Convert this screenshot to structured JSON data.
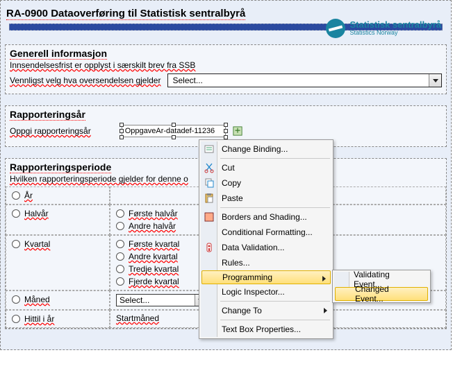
{
  "brand": {
    "name": "Statistisk sentralbyrå",
    "sub": "Statistics Norway",
    "accent": "#1a84a0"
  },
  "form": {
    "title": "RA-0900 Dataoverføring til Statistisk sentralbyrå",
    "general": {
      "heading": "Generell informasjon",
      "line1": "Innsendelsesfrist er opplyst i særskilt brev fra SSB",
      "prompt_label": "Vennligst velg hva oversendelsen gjelder",
      "select_placeholder": "Select..."
    },
    "year": {
      "heading": "Rapporteringsår",
      "label": "Oppgi rapporteringsår",
      "field_binding": "OppgaveAr-datadef-11236"
    },
    "period": {
      "heading": "Rapporteringsperiode",
      "subtitle": "Hvilken rapporteringsperiode gjelder for denne o",
      "row_year": "År",
      "row_half": "Halvår",
      "half_options": [
        "Første halvår",
        "Andre halvår"
      ],
      "row_quarter": "Kvartal",
      "quarter_options": [
        "Første kvartal",
        "Andre kvartal",
        "Tredje kvartal",
        "Fjerde kvartal"
      ],
      "row_month": "Måned",
      "month_select": "Select...",
      "row_ytd": "Hittil i år",
      "ytd_value": "Startmåned"
    }
  },
  "context_menu": {
    "change_binding": "Change Binding...",
    "cut": "Cut",
    "copy": "Copy",
    "paste": "Paste",
    "borders": "Borders and Shading...",
    "cond_fmt": "Conditional Formatting...",
    "data_val": "Data Validation...",
    "rules": "Rules...",
    "programming": "Programming",
    "logic": "Logic Inspector...",
    "change_to": "Change To",
    "props": "Text Box Properties..."
  },
  "submenu": {
    "validating": "Validating Event...",
    "changed": "Changed Event..."
  }
}
